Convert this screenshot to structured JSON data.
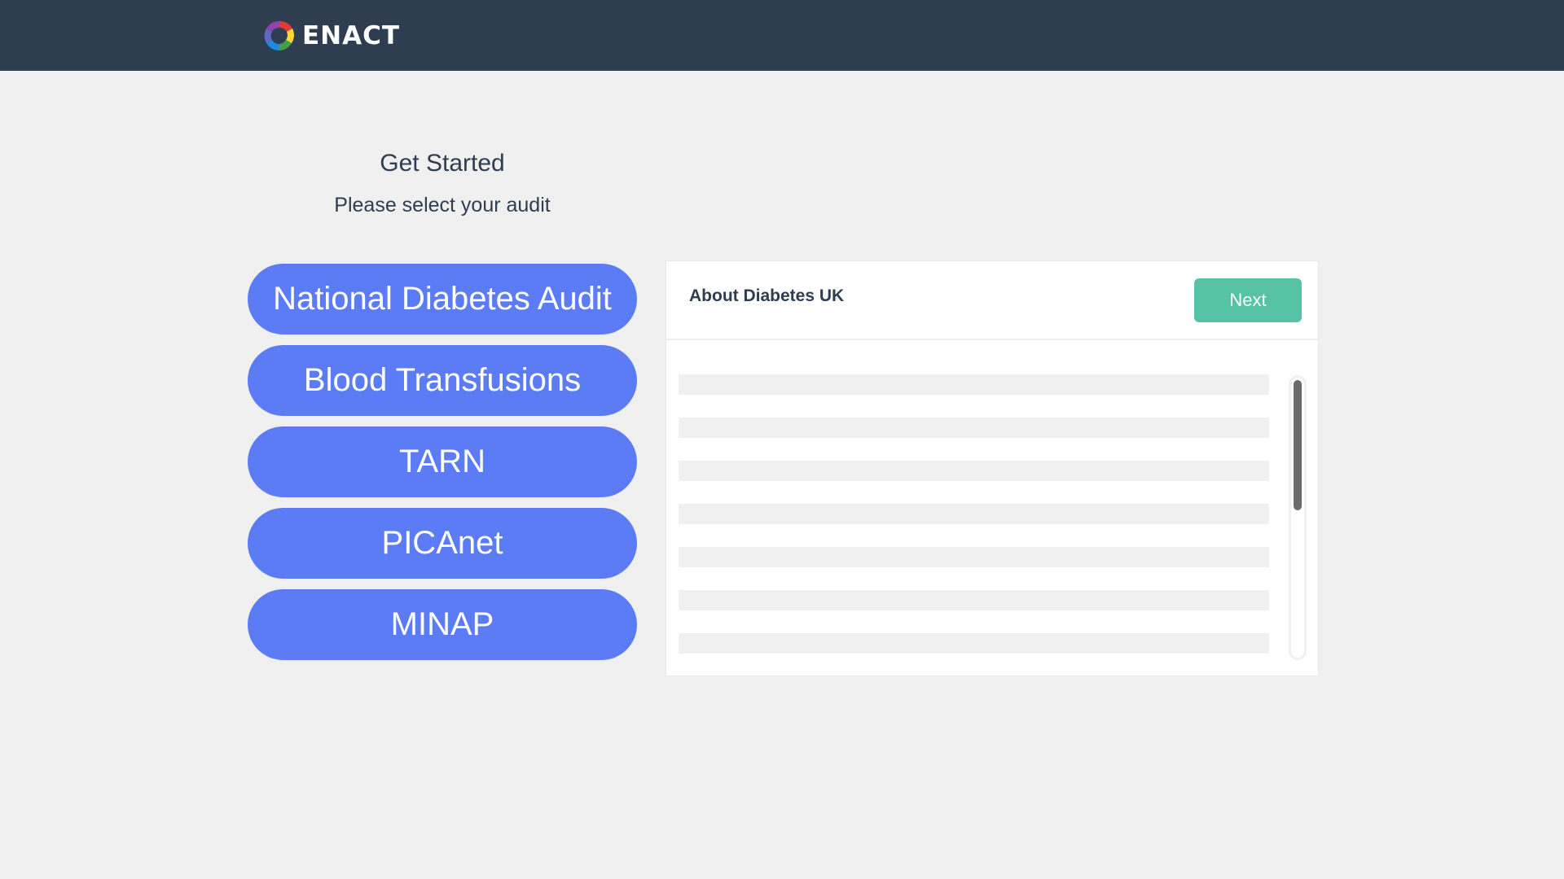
{
  "header": {
    "logo_text": "ENACT",
    "logo_icon": "enact-logo-icon",
    "background": "#2e3d4f"
  },
  "intro": {
    "title": "Get Started",
    "subtitle": "Please select your audit"
  },
  "audits": [
    {
      "label": "National Diabetes Audit"
    },
    {
      "label": "Blood Transfusions"
    },
    {
      "label": "TARN"
    },
    {
      "label": "PICAnet"
    },
    {
      "label": "MINAP"
    }
  ],
  "panel": {
    "title": "About Diabetes UK",
    "next_label": "Next"
  },
  "colors": {
    "audit_button": "#5c7cf5",
    "next_button": "#56c2a6",
    "page_background": "#f0f0f0"
  }
}
